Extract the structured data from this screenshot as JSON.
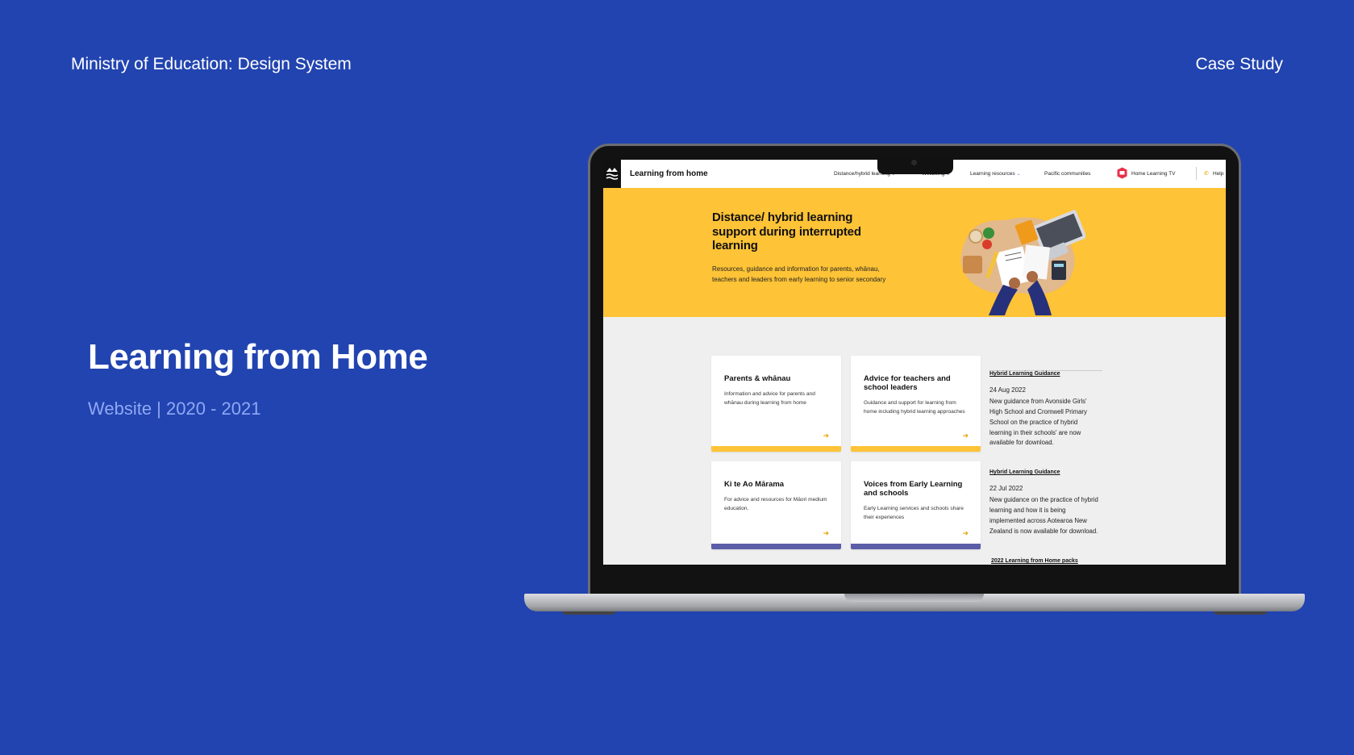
{
  "slide": {
    "header_left": "Ministry of Education: Design System",
    "header_right": "Case Study",
    "title": "Learning from Home",
    "subtitle": "Website | 2020 - 2021"
  },
  "site": {
    "name": "Learning from home",
    "nav": [
      {
        "label": "Distance/hybrid learning",
        "has_dropdown": true
      },
      {
        "label": "Wellbeing",
        "has_dropdown": true
      },
      {
        "label": "Learning resources",
        "has_dropdown": true
      },
      {
        "label": "Pacific communities",
        "has_dropdown": false
      },
      {
        "label": "Home Learning TV",
        "has_dropdown": false
      },
      {
        "label": "Help",
        "has_dropdown": false
      }
    ],
    "hero": {
      "title": "Distance/ hybrid learning support during interrupted learning",
      "description": "Resources, guidance and information for parents, whānau, teachers and leaders from early learning to senior secondary"
    },
    "cards": [
      {
        "title": "Parents & whānau",
        "description": "Information and advice for parents and whānau during learning from home",
        "bar_color": "#fec336"
      },
      {
        "title": "Advice for teachers and school leaders",
        "description": "Guidance and support for learning from home including hybrid learning approaches",
        "bar_color": "#fec336"
      },
      {
        "title": "Ki te Ao Mārama",
        "description": "For advice and resources for Māori medium education.",
        "bar_color": "#5c5ea8"
      },
      {
        "title": "Voices from Early Learning and schools",
        "description": "Early Learning services and schools share their experiences",
        "bar_color": "#5c5ea8"
      }
    ],
    "news": [
      {
        "link": "Hybrid Learning Guidance",
        "date": "24 Aug 2022",
        "body": "New guidance from Avonside Girls' High School and Cromwell Primary School on the practice of hybrid learning in their schools' are now available for download."
      },
      {
        "link": "Hybrid Learning Guidance",
        "date": "22 Jul 2022",
        "body": "New guidance on the practice of hybrid learning and how it is being implemented across Aotearoa New Zealand is now available for download."
      },
      {
        "link": "2022 Learning from Home packs"
      }
    ]
  },
  "colors": {
    "background": "#2244b0",
    "subtitle": "#8fa8f5",
    "hero_yellow": "#fec336",
    "card_purple": "#5c5ea8",
    "accent_orange": "#e8a400"
  },
  "icons": {
    "logo": "moe-logo-icon",
    "arrow": "arrow-right-icon",
    "tv": "home-learning-tv-icon",
    "phone": "phone-icon",
    "chevron": "chevron-down-icon"
  }
}
